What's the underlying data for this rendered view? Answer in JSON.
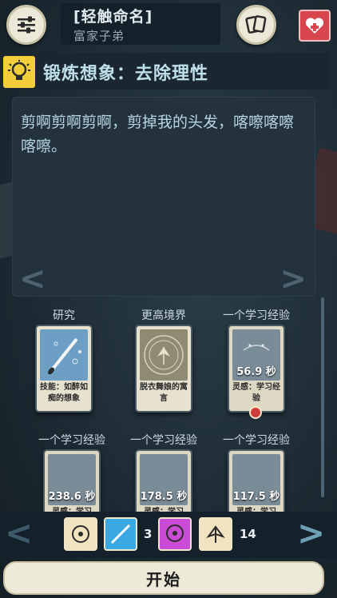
{
  "topbar": {
    "menu_icon": "sliders-icon",
    "legacy_name": "[轻触命名]",
    "legacy_subtitle": "富家子弟",
    "cards_icon": "cards-icon",
    "health_icon": "heart-plus-icon"
  },
  "header": {
    "icon": "lightbulb-icon",
    "title": "锻炼想象：去除理性"
  },
  "description": {
    "text": "剪啊剪啊剪啊，剪掉我的头发，喀嚓喀嚓喀嚓。",
    "prev_arrow": "<",
    "next_arrow": ">"
  },
  "slots": [
    {
      "label": "研究",
      "card_name": "技能：如醉如痴的想象",
      "timer": "",
      "art": "brush"
    },
    {
      "label": "更高境界",
      "card_name": "脱衣舞娘的寓言",
      "timer": "",
      "art": "moth-circle"
    },
    {
      "label": "一个学习经验",
      "card_name": "灵感：学习经验",
      "timer": "56.9 秒",
      "art": "dim"
    },
    {
      "label": "一个学习经验",
      "card_name": "灵感：学习",
      "timer": "238.6 秒",
      "art": "dim"
    },
    {
      "label": "一个学习经验",
      "card_name": "灵感：学习",
      "timer": "178.5 秒",
      "art": "dim"
    },
    {
      "label": "一个学习经验",
      "card_name": "灵感：学习",
      "timer": "117.5 秒",
      "art": "dim"
    }
  ],
  "aspects": [
    {
      "icon": "lantern-head-icon",
      "color": "#f1e3c0",
      "count": ""
    },
    {
      "icon": "brush-icon",
      "color": "#3aa9e4",
      "count": "3"
    },
    {
      "icon": "heart-head-icon",
      "color": "#c94bd6",
      "count": ""
    },
    {
      "icon": "moth-icon",
      "color": "#f1e3c0",
      "count": "14"
    }
  ],
  "bottom": {
    "prev_arrow": "<",
    "next_arrow": ">"
  },
  "start_button": "开始"
}
